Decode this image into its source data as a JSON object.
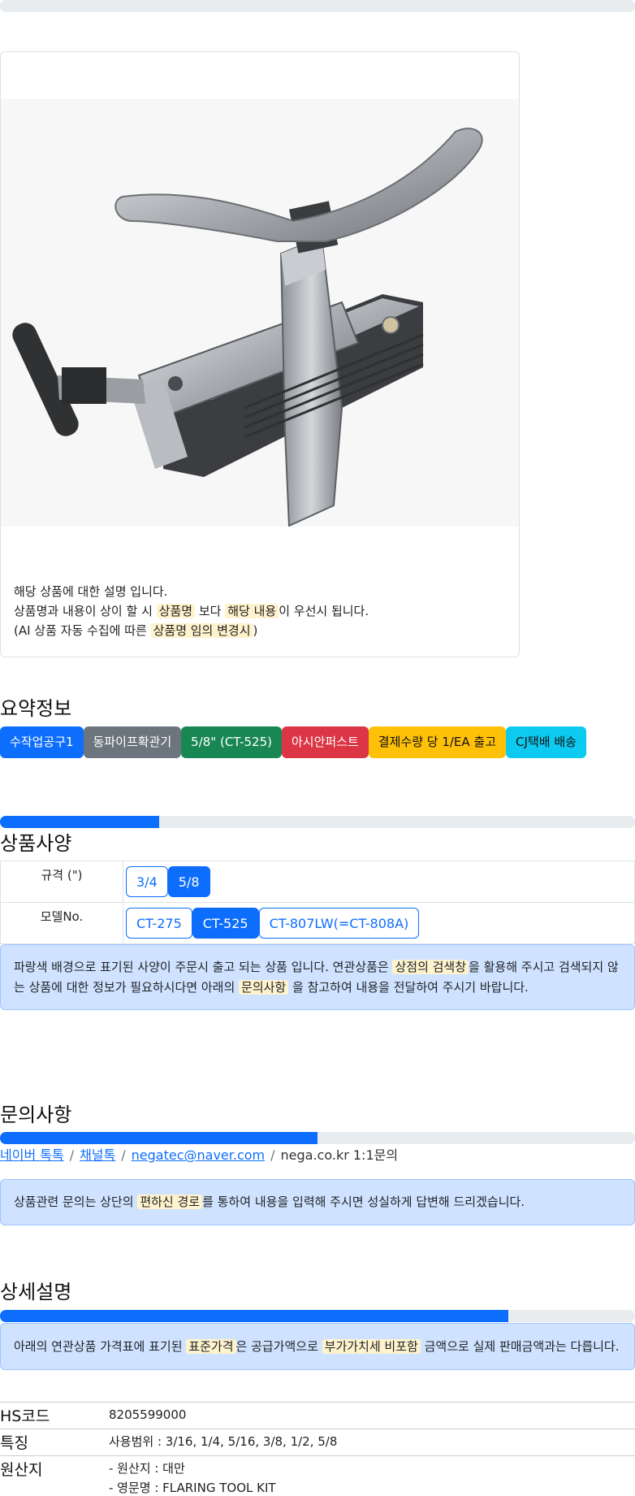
{
  "card": {
    "image_alt": "CT-525 flaring tool",
    "line1": "해당 상품에 대한 설명 입니다.",
    "line2_a": "상품명과 내용이 상이 할 시",
    "line2_hl1": "상품명",
    "line2_b": "보다",
    "line2_hl2": "해당 내용",
    "line2_c": "이 우선시 됩니다.",
    "line3_a": "(AI 상품 자동 수집에 따른",
    "line3_hl": "상품명 임의 변경시",
    "line3_b": ")"
  },
  "summary": {
    "title": "요약정보",
    "badges": [
      "수작업공구1",
      "동파이프확관기",
      "5/8\" (CT-525)",
      "아시안퍼스트",
      "결제수량 당 1/EA 출고",
      "CJ택배 배송"
    ]
  },
  "specs": {
    "title": "상품사양",
    "progress_fraction": 0.25,
    "rows": [
      {
        "label": "규격 (\")",
        "options": [
          "3/4",
          "5/8"
        ],
        "selected": "5/8"
      },
      {
        "label": "모델No.",
        "options": [
          "CT-275",
          "CT-525",
          "CT-807LW(=CT-808A)"
        ],
        "selected": "CT-525"
      }
    ],
    "notice_a": "파랑색 배경으로 표기된 사양이 주문시 출고 되는 상품 입니다. 연관상품은",
    "notice_hl1": "상점의 검색창",
    "notice_b": "을 활용해 주시고 검색되지 않는 상품에 대한 정보가 필요하시다면 아래의",
    "notice_hl2": "문의사항",
    "notice_c": "을 참고하여 내용을 전달하여 주시기 바랍니다."
  },
  "inquiry": {
    "title": "문의사항",
    "progress_fraction": 0.5,
    "links": [
      "네이버 톡톡",
      "채널톡",
      "negatec@naver.com"
    ],
    "plain": "nega.co.kr 1:1문의",
    "separator": "/",
    "notice_a": "상품관련 문의는 상단의",
    "notice_hl": "편하신 경로",
    "notice_b": "를 통하여 내용을 입력해 주시면 성실하게 답변해 드리겠습니다."
  },
  "detail": {
    "title": "상세설명",
    "progress_fraction": 0.8,
    "notice_a": "아래의 연관상품 가격표에 표기된",
    "notice_hl1": "표준가격",
    "notice_b": "은 공급가액으로",
    "notice_hl2": "부가가치세 비포함",
    "notice_c": "금액으로 실제 판매금액과는 다릅니다.",
    "rows": [
      {
        "key": "HS코드",
        "value": "8205599000"
      },
      {
        "key": "특징",
        "value": "사용범위 : 3/16, 1/4, 5/16, 3/8, 1/2, 5/8"
      },
      {
        "key": "원산지",
        "value": "- 원산지 : 대만",
        "value2": "- 영문명 : FLARING TOOL KIT"
      }
    ]
  },
  "colors": {
    "primary": "#0d6efd",
    "secondary": "#6c757d",
    "success": "#198754",
    "danger": "#dc3545",
    "warning": "#ffc107",
    "info": "#0dcaf0",
    "alert_bg": "#cfe2ff",
    "highlight": "#fff3cd"
  }
}
